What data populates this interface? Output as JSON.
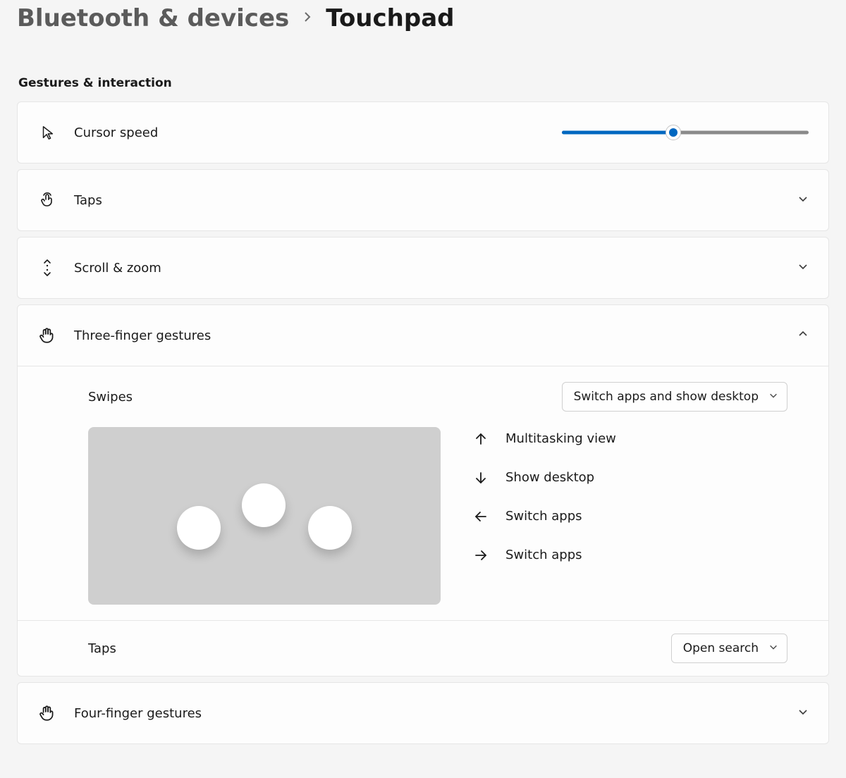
{
  "breadcrumb": {
    "parent": "Bluetooth & devices",
    "current": "Touchpad"
  },
  "section_title": "Gestures & interaction",
  "cursor_speed": {
    "label": "Cursor speed",
    "percent": 45
  },
  "rows": {
    "taps": "Taps",
    "scroll_zoom": "Scroll & zoom",
    "three_finger": "Three-finger gestures",
    "four_finger": "Four-finger gestures"
  },
  "three_finger": {
    "swipes_label": "Swipes",
    "swipes_value": "Switch apps and show desktop",
    "directions": {
      "up": "Multitasking view",
      "down": "Show desktop",
      "left": "Switch apps",
      "right": "Switch apps"
    },
    "taps_label": "Taps",
    "taps_value": "Open search"
  }
}
